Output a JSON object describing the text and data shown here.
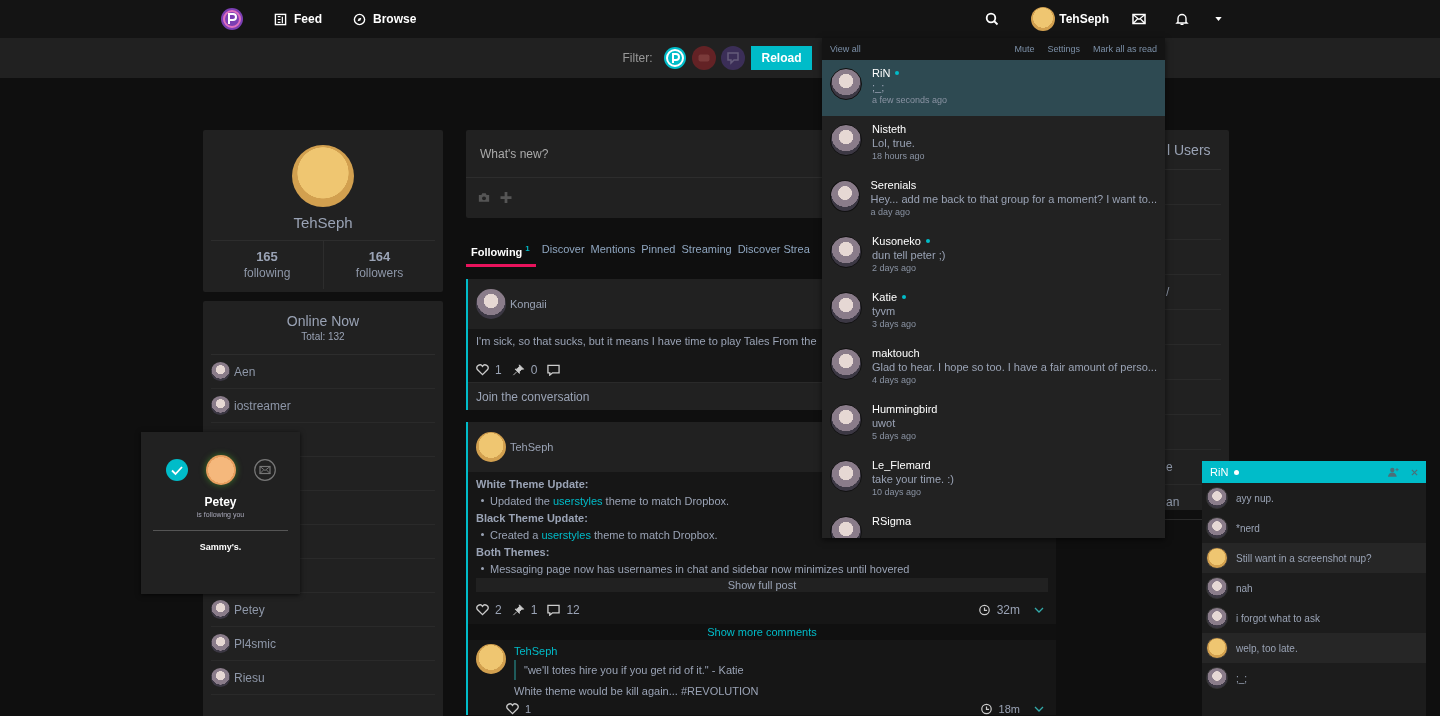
{
  "nav": {
    "links": [
      {
        "label": "Feed",
        "kind": "feed"
      },
      {
        "label": "Browse",
        "kind": "browse"
      }
    ],
    "user": "TehSeph"
  },
  "filter": {
    "label": "Filter:",
    "sources": [
      {
        "kind": "site",
        "selected": true
      },
      {
        "kind": "video",
        "selected": false
      },
      {
        "kind": "chat",
        "selected": false
      }
    ],
    "reload": "Reload"
  },
  "profile": {
    "name": "TehSeph",
    "stats": [
      {
        "value": "165",
        "label": "following"
      },
      {
        "value": "164",
        "label": "followers"
      }
    ]
  },
  "online": {
    "title": "Online Now",
    "total": "Total: 132",
    "users_top": [
      "Aen",
      "iostreamer"
    ],
    "users_bottom": [
      "Petey",
      "Pl4smic",
      "Riesu"
    ]
  },
  "follow_popup": {
    "name": "Petey",
    "subtitle": "is following you",
    "bio": "Sammy's."
  },
  "composer": {
    "placeholder": "What's new?"
  },
  "tabs": [
    {
      "label": "Following",
      "badge": "1",
      "selected": true
    },
    {
      "label": "Discover",
      "selected": false
    },
    {
      "label": "Mentions",
      "selected": false
    },
    {
      "label": "Pinned",
      "selected": false
    },
    {
      "label": "Streaming",
      "selected": false
    },
    {
      "label": "Discover Strea",
      "selected": false
    }
  ],
  "post1": {
    "author": "Kongaii",
    "text": "I'm sick, so that sucks, but it means I have time to play Tales From the",
    "likes": "1",
    "pins": "0",
    "join": "Join the conversation"
  },
  "post2": {
    "author": "TehSeph",
    "sections": [
      {
        "heading": "White Theme Update:",
        "bullet": [
          "Updated the ",
          "userstyles",
          " theme to match Dropbox."
        ]
      },
      {
        "heading": "Black Theme Update:",
        "bullet": [
          "Created a ",
          "userstyles",
          " theme to match Dropbox."
        ]
      },
      {
        "heading": "Both Themes:",
        "bullet": [
          "Messaging page now has usernames in chat and sidebar now minimizes until hovered"
        ]
      }
    ],
    "show_full": "Show full post",
    "likes": "2",
    "pins": "1",
    "comments": "12",
    "time": "32m",
    "more_comments": "Show more comments",
    "comment": {
      "author": "TehSeph",
      "quote": "\"we'll totes hire you if you get rid of it.\" - Katie",
      "text": "White theme would be kill again... #REVOLUTION",
      "likes": "1",
      "time": "18m"
    }
  },
  "right_panel": {
    "title": "l Users",
    "fragments": [
      "/",
      "e",
      "an"
    ]
  },
  "notifications": {
    "actions": {
      "view_all": "View all",
      "mute": "Mute",
      "settings": "Settings",
      "mark_read": "Mark all as read"
    },
    "items": [
      {
        "name": "RiN",
        "online": true,
        "selected": true,
        "message": ";_;",
        "time": "a few seconds ago"
      },
      {
        "name": "Nisteth",
        "online": false,
        "selected": false,
        "message": "Lol, true.",
        "time": "18 hours ago"
      },
      {
        "name": "Serenials",
        "online": false,
        "selected": false,
        "message": "Hey... add me back to that group for a moment? I want to...",
        "time": "a day ago"
      },
      {
        "name": "Kusoneko",
        "online": true,
        "selected": false,
        "message": "dun tell peter ;)",
        "time": "2 days ago"
      },
      {
        "name": "Katie",
        "online": true,
        "selected": false,
        "message": "tyvm",
        "time": "3 days ago"
      },
      {
        "name": "maktouch",
        "online": false,
        "selected": false,
        "message": "Glad to hear. I hope so too. I have a fair amount of perso...",
        "time": "4 days ago"
      },
      {
        "name": "Hummingbird",
        "online": false,
        "selected": false,
        "message": "uwot",
        "time": "5 days ago"
      },
      {
        "name": "Le_Flemard",
        "online": false,
        "selected": false,
        "message": "take your time. :)",
        "time": "10 days ago"
      },
      {
        "name": "RSigma",
        "online": false,
        "selected": false
      }
    ]
  },
  "chat": {
    "name": "RiN",
    "online": true,
    "messages": [
      {
        "text": "ayy nup.",
        "from_me": false
      },
      {
        "text": "*nerd",
        "from_me": false
      },
      {
        "text": "Still want in a screenshot nup?",
        "from_me": true
      },
      {
        "text": "nah",
        "from_me": false
      },
      {
        "text": "i forgot what to ask",
        "from_me": false
      },
      {
        "text": "welp, too late.",
        "from_me": true
      },
      {
        "text": ";_;",
        "from_me": false
      }
    ]
  }
}
